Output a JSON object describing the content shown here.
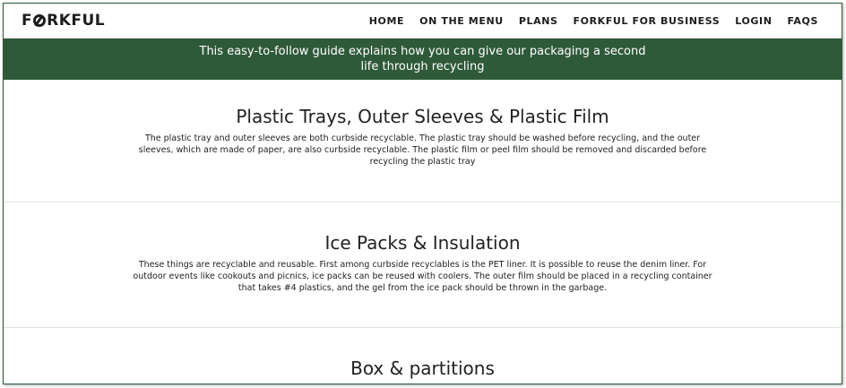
{
  "brand": {
    "logo_text_left": "F",
    "logo_text_right": "RKFUL"
  },
  "nav": {
    "items": [
      "HOME",
      "ON THE MENU",
      "PLANS",
      "FORKFUL FOR BUSINESS",
      "LOGIN",
      "FAQS"
    ]
  },
  "banner": {
    "text": "This easy-to-follow guide explains how you can give our packaging a second life through recycling"
  },
  "sections": [
    {
      "title": "Plastic Trays, Outer Sleeves & Plastic Film",
      "body": "The plastic tray and outer sleeves are both curbside recyclable. The plastic tray should be washed before recycling, and the outer sleeves, which are made of paper, are also curbside recyclable. The plastic film or peel film should be removed and discarded before recycling the plastic tray"
    },
    {
      "title": "Ice Packs & Insulation",
      "body": "These things are recyclable and reusable. First among curbside recyclables is the PET liner. It is possible to reuse the denim liner. For outdoor events like cookouts and picnics, ice packs can be reused with coolers. The outer film should be placed in a recycling container that takes #4 plastics, and the gel from the ice pack should be thrown in the garbage."
    },
    {
      "title": "Box & partitions",
      "body": ""
    }
  ],
  "colors": {
    "brand_green": "#2f5a3a",
    "text": "#222222",
    "nav_text": "#1d1d1d"
  }
}
